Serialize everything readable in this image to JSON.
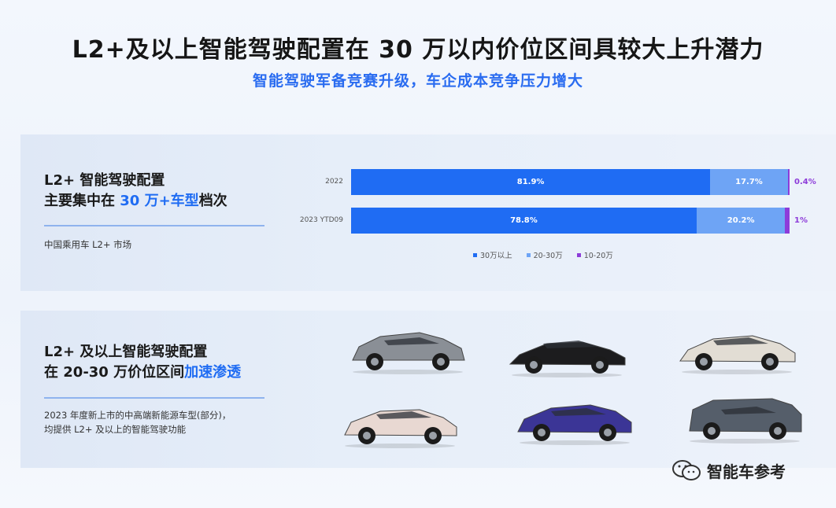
{
  "title": "L2+及以上智能驾驶配置在 30 万以内价位区间具较大上升潜力",
  "subtitle": "智能驾驶军备竞赛升级，车企成本竞争压力增大",
  "top_panel": {
    "heading_line1": "L2+ 智能驾驶配置",
    "heading_line2_a": "主要集中在 ",
    "heading_line2_hl": "30 万+车型",
    "heading_line2_b": "档次",
    "note": "中国乘用车 L2+ 市场"
  },
  "bottom_panel": {
    "heading_line1": "L2+ 及以上智能驾驶配置",
    "heading_line2_a": "在 20-30 万价位区间",
    "heading_line2_hl": "加速渗透",
    "note_line1": "2023 年度新上市的中高端新能源车型(部分)，",
    "note_line2": "均提供 L2+ 及以上的智能驾驶功能"
  },
  "chart_data": {
    "type": "bar",
    "orientation": "horizontal",
    "stacked": true,
    "categories": [
      "2022",
      "2023 YTD09"
    ],
    "series": [
      {
        "name": "30万以上",
        "values": [
          81.9,
          78.8
        ],
        "labels": [
          "81.9%",
          "78.8%"
        ],
        "color": "#1f6cf3"
      },
      {
        "name": "20-30万",
        "values": [
          17.7,
          20.2
        ],
        "labels": [
          "17.7%",
          "20.2%"
        ],
        "color": "#6ea4f5"
      },
      {
        "name": "10-20万",
        "values": [
          0.4,
          1.0
        ],
        "labels": [
          "0.4%",
          "1%"
        ],
        "color": "#8d3cd9"
      }
    ],
    "legend_position": "bottom",
    "grid": false
  },
  "cars": [
    {
      "name": "gray-crossover",
      "body": "#8a8f96"
    },
    {
      "name": "black-sedan",
      "body": "#1c1c1e"
    },
    {
      "name": "white-sedan",
      "body": "#e2ddd4"
    },
    {
      "name": "pink-crossover",
      "body": "#e8d8d2"
    },
    {
      "name": "purple-crossover",
      "body": "#3b3596"
    },
    {
      "name": "gray-suv",
      "body": "#555e6a"
    }
  ],
  "watermark": {
    "text": "智能车参考",
    "icon": "wechat-icon"
  }
}
